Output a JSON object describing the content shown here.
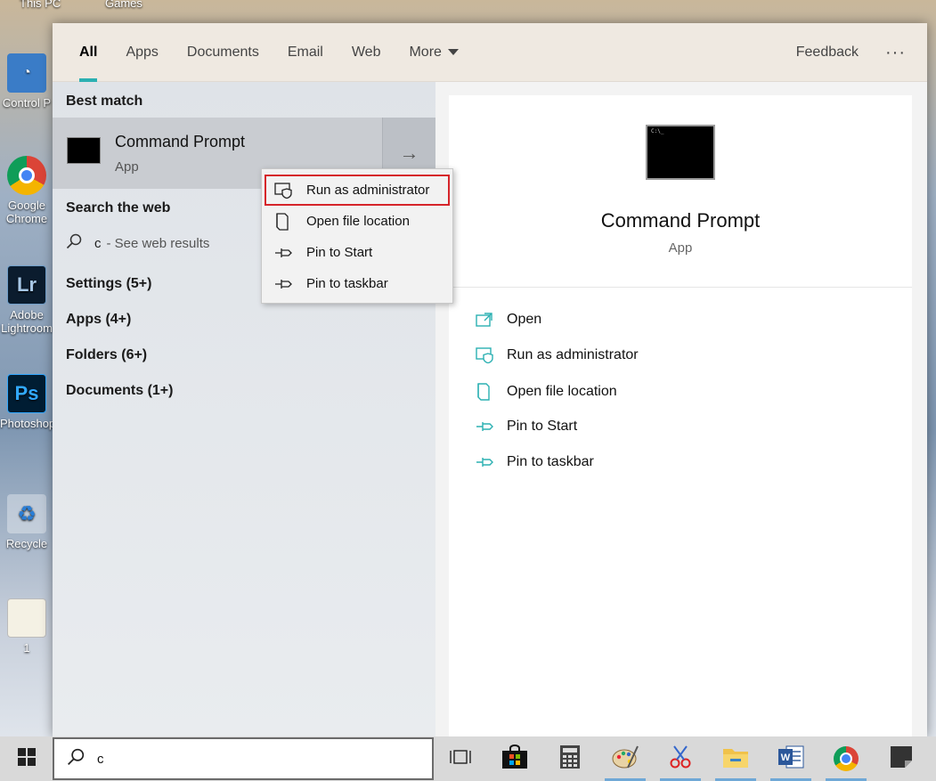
{
  "desktop": {
    "top_labels": [
      "This PC",
      "Games"
    ],
    "icons": [
      {
        "label": "Control P",
        "name": "control-panel-icon"
      },
      {
        "label": "Google Chrome",
        "name": "chrome-desktop-icon"
      },
      {
        "label": "Adobe Lightroom",
        "name": "lightroom-desktop-icon"
      },
      {
        "label": "Photoshop",
        "name": "photoshop-desktop-icon"
      },
      {
        "label": "Recycle",
        "name": "recycle-bin-icon"
      },
      {
        "label": "1",
        "name": "file-desktop-icon"
      }
    ]
  },
  "tabs": {
    "items": [
      "All",
      "Apps",
      "Documents",
      "Email",
      "Web",
      "More"
    ],
    "active": "All",
    "feedback": "Feedback",
    "more_options": "···"
  },
  "left": {
    "best_match_title": "Best match",
    "best_match": {
      "title": "Command Prompt",
      "subtitle": "App"
    },
    "search_web_title": "Search the web",
    "web_query": "c",
    "web_suffix": "- See web results",
    "categories": [
      "Settings (5+)",
      "Apps (4+)",
      "Folders (6+)",
      "Documents (1+)"
    ]
  },
  "context_menu": {
    "items": [
      "Run as administrator",
      "Open file location",
      "Pin to Start",
      "Pin to taskbar"
    ],
    "highlighted": "Run as administrator"
  },
  "right": {
    "title": "Command Prompt",
    "subtitle": "App",
    "actions": [
      "Open",
      "Run as administrator",
      "Open file location",
      "Pin to Start",
      "Pin to taskbar"
    ]
  },
  "taskbar": {
    "search_value": "c",
    "pinned": [
      "task-view-icon",
      "store-icon",
      "calculator-icon",
      "paint-icon",
      "snipping-tool-icon",
      "file-explorer-icon",
      "word-icon",
      "chrome-icon",
      "sticky-notes-icon"
    ]
  },
  "colors": {
    "accent": "#2bb0b2",
    "highlight_border": "#d6242a"
  }
}
